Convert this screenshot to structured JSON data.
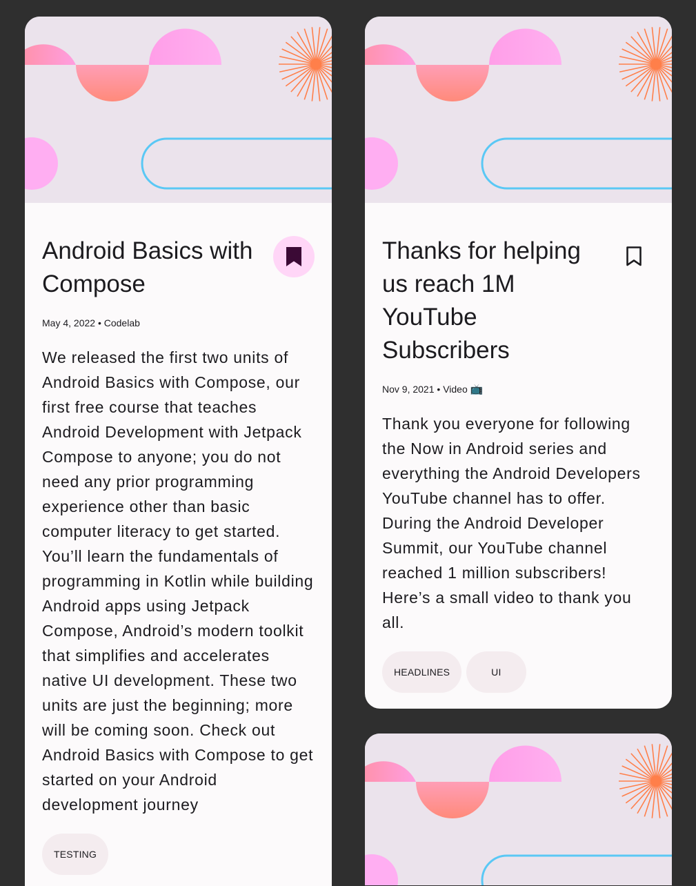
{
  "feed": {
    "cards": [
      {
        "title": "Android Basics with Compose",
        "bookmarked": true,
        "date": "May 4, 2022",
        "separator": "•",
        "type": "Codelab",
        "description": "We released the first two units of Android Basics with Compose, our first free course that teaches Android Development with Jetpack Compose to anyone; you do not need any prior programming experience other than basic computer literacy to get started. You’ll learn the fundamentals of programming in Kotlin while building Android apps using Jetpack Compose, Android’s modern toolkit that simplifies and accelerates native UI development. These two units are just the beginning; more will be coming soon. Check out Android Basics with Compose to get started on your Android development journey",
        "topics": [
          "TESTING"
        ]
      },
      {
        "title": "Thanks for helping us reach 1M YouTube Subscribers",
        "bookmarked": false,
        "date": "Nov 9, 2021",
        "separator": "•",
        "type": "Video",
        "type_emoji": "📺",
        "description": "Thank you everyone for following the Now in Android series and everything the Android Developers YouTube channel has to offer. During the Android Developer Summit, our YouTube channel reached 1 million subscribers! Here’s a small video to thank you all.",
        "topics": [
          "HEADLINES",
          "UI"
        ]
      }
    ]
  },
  "colors": {
    "background": "#2f2f2f",
    "card": "#fcfafb",
    "header_bg": "#ebe3ec",
    "bookmark_bg": "#ffd6f7",
    "bookmark_icon": "#3b0a35",
    "chip_bg": "#f4ecef",
    "coral": "#ff8a84",
    "pink": "#ff9ee8",
    "orange_burst": "#ff7f4a",
    "blue_outline": "#5ac8f5"
  },
  "icons": {
    "bookmark_filled": "bookmark-filled-icon",
    "bookmark_outline": "bookmark-outline-icon"
  }
}
